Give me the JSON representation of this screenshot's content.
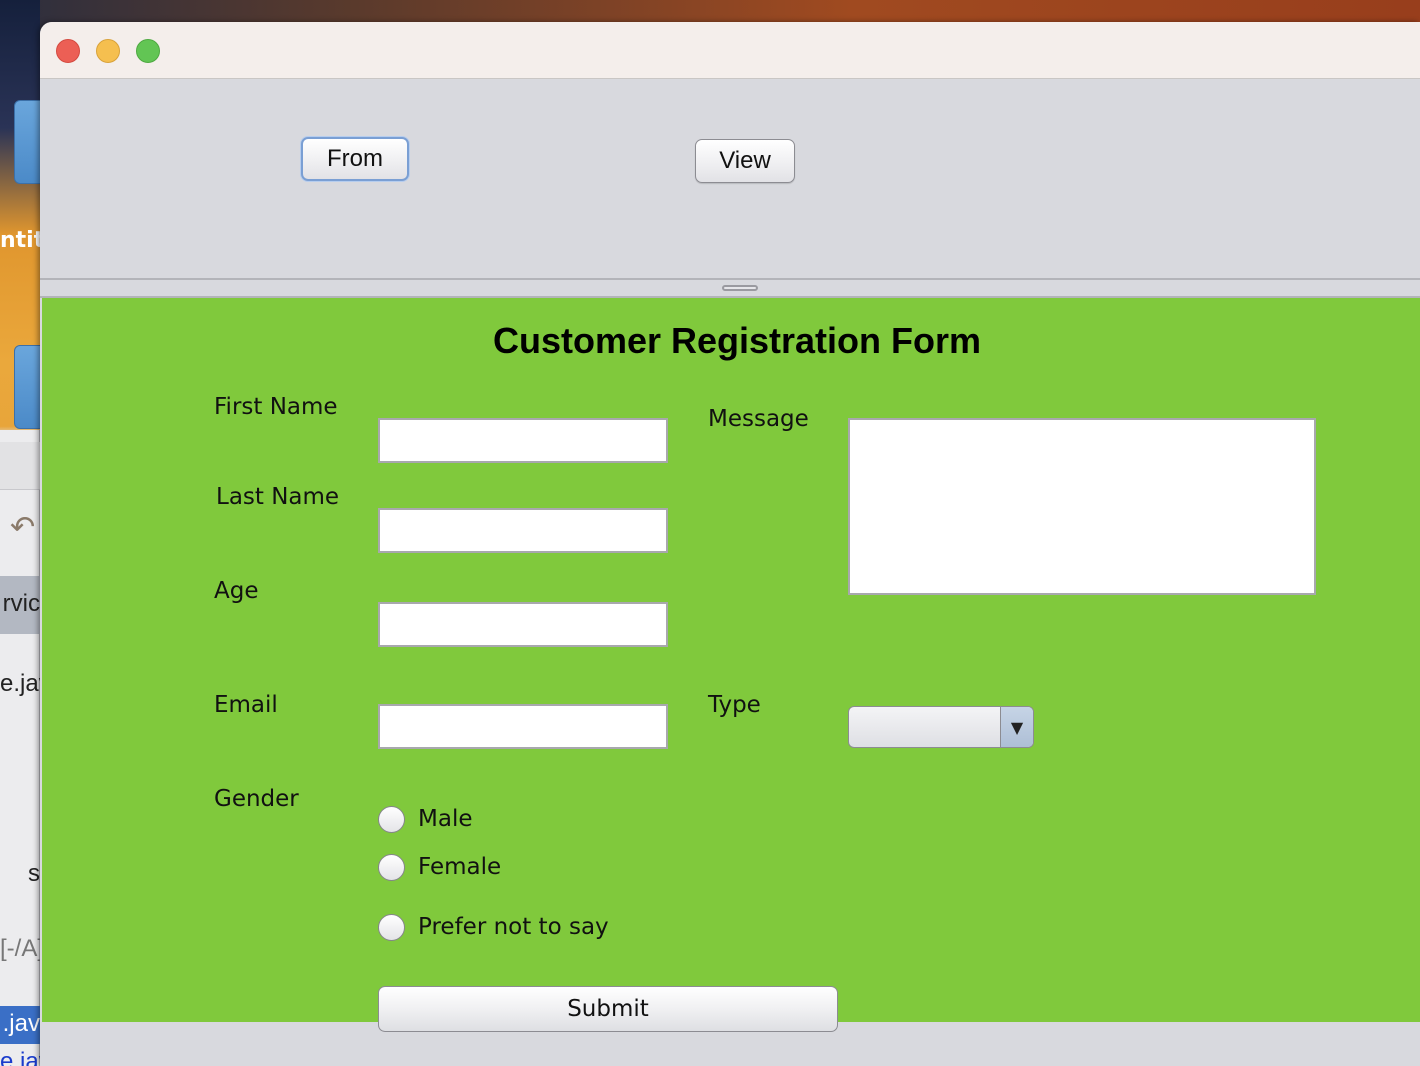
{
  "desktop": {
    "label_fragment_1": "ntit",
    "behind_rows": [
      "rvic",
      "e.jav",
      "s",
      "[-/A]",
      ".jav",
      "e.jav"
    ]
  },
  "window": {
    "toolbar": {
      "from_label": "From",
      "view_label": "View"
    },
    "form": {
      "title": "Customer Registration Form",
      "labels": {
        "first_name": "First Name",
        "last_name": "Last Name",
        "age": "Age",
        "email": "Email",
        "gender": "Gender",
        "message": "Message",
        "type": "Type"
      },
      "values": {
        "first_name": "",
        "last_name": "",
        "age": "",
        "email": "",
        "message": ""
      },
      "type_selected": "",
      "gender_options": [
        "Male",
        "Female",
        "Prefer not to say"
      ],
      "submit_label": "Submit"
    }
  },
  "colors": {
    "form_background": "#80c93c",
    "window_background": "#d8d9de"
  }
}
